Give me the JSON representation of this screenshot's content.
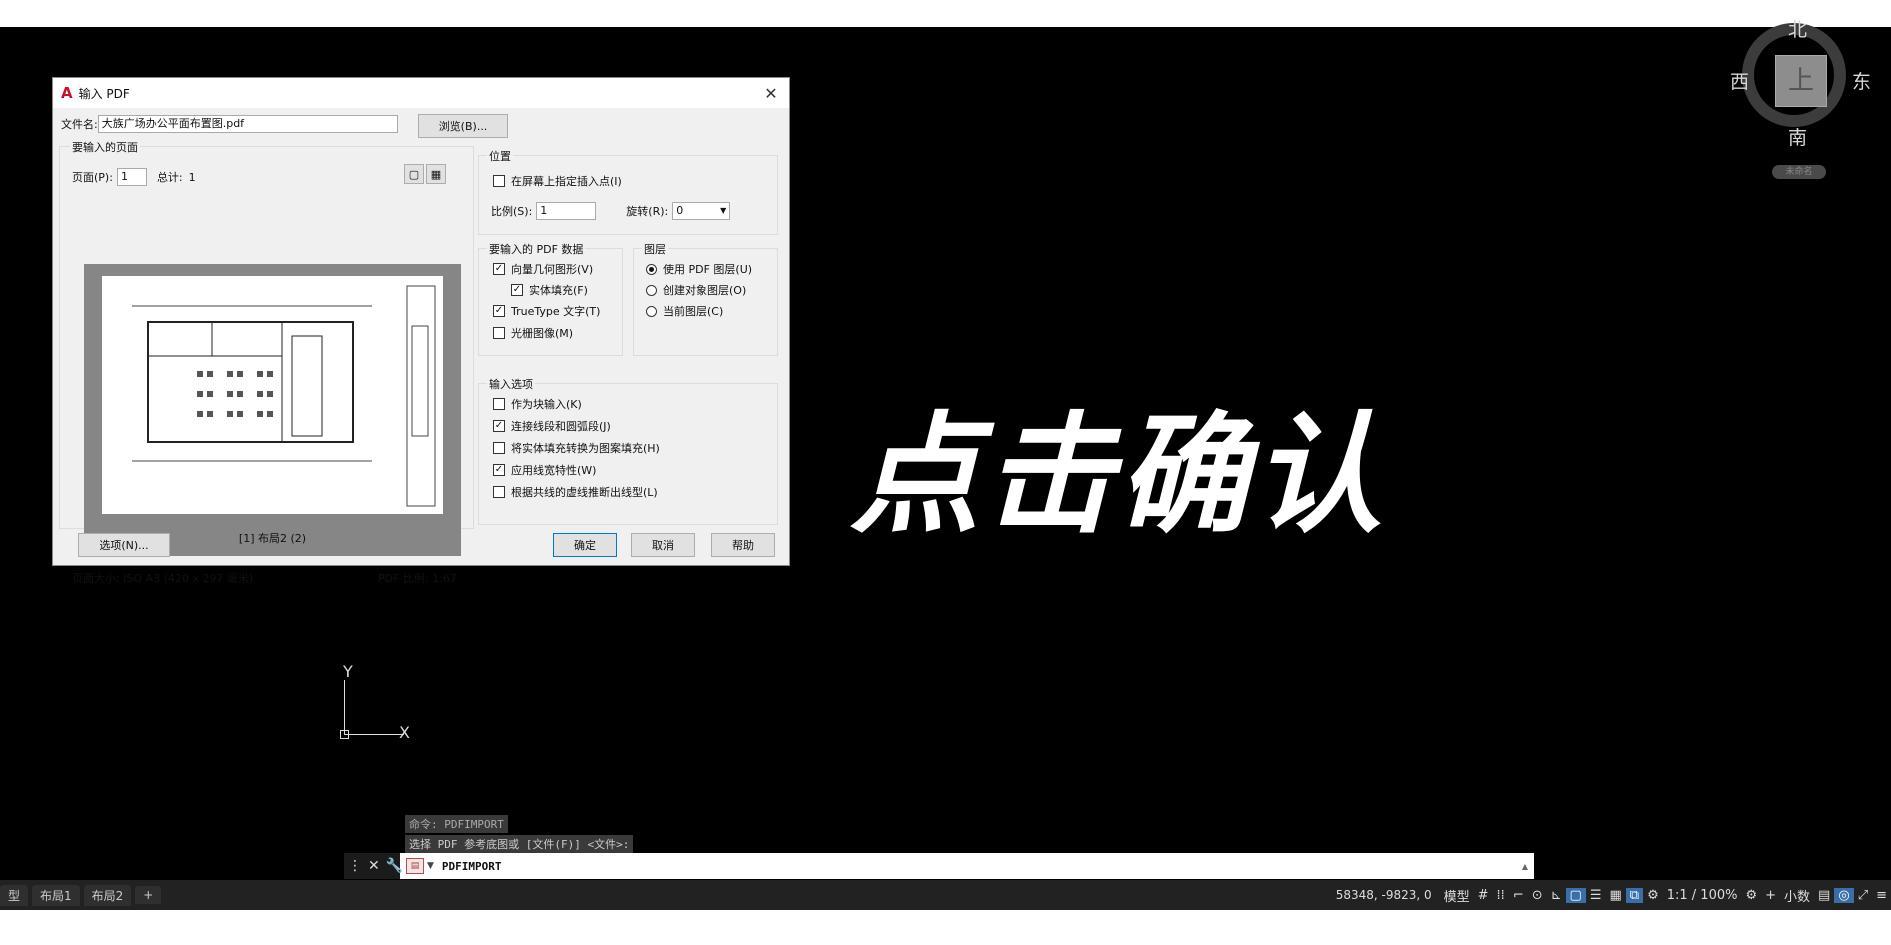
{
  "viewcube": {
    "north": "北",
    "west": "西",
    "east": "东",
    "south": "南",
    "face": "上",
    "wcs_label": "未命名"
  },
  "caption": "点击确认",
  "ucs": {
    "x": "X",
    "y": "Y"
  },
  "command": {
    "history1": "命令: PDFIMPORT",
    "history2": "选择 PDF 参考底图或 [文件(F)] <文件>:",
    "current": "PDFIMPORT"
  },
  "status": {
    "tabs": [
      "型",
      "布局1",
      "布局2",
      "+"
    ],
    "coords": "58348, -9823, 0",
    "model_label": "模型",
    "scale": "1:1 / 100%",
    "units": "小数"
  },
  "dialog": {
    "title": "输入 PDF",
    "filename_label": "文件名:",
    "filename_value": "大族广场办公平面布置图.pdf",
    "browse": "浏览(B)...",
    "pages_group": "要输入的页面",
    "page_label": "页面(P):",
    "page_value": "1",
    "total_label": "总计:",
    "total_value": "1",
    "preview_caption": "[1] 布局2 (2)",
    "page_size": "页面大小: ISO A3 (420 x 297 毫米)",
    "pdf_scale": "PDF 比例: 1:67",
    "position_group": "位置",
    "specify_on_screen": "在屏幕上指定插入点(I)",
    "scale_label": "比例(S):",
    "scale_value": "1",
    "rotation_label": "旋转(R):",
    "rotation_value": "0",
    "pdf_data_group": "要输入的 PDF 数据",
    "vector_geometry": "向量几何图形(V)",
    "solid_fill": "实体填充(F)",
    "truetype_text": "TrueType 文字(T)",
    "raster_images": "光栅图像(M)",
    "layers_group": "图层",
    "use_pdf_layers": "使用 PDF 图层(U)",
    "create_object_layers": "创建对象图层(O)",
    "current_layer": "当前图层(C)",
    "import_options_group": "输入选项",
    "import_as_block": "作为块输入(K)",
    "join_segments": "连接线段和圆弧段(J)",
    "convert_fills": "将实体填充转换为图案填充(H)",
    "apply_lineweight": "应用线宽特性(W)",
    "infer_linetypes": "根据共线的虚线推断出线型(L)",
    "options_btn": "选项(N)...",
    "ok_btn": "确定",
    "cancel_btn": "取消",
    "help_btn": "帮助"
  }
}
